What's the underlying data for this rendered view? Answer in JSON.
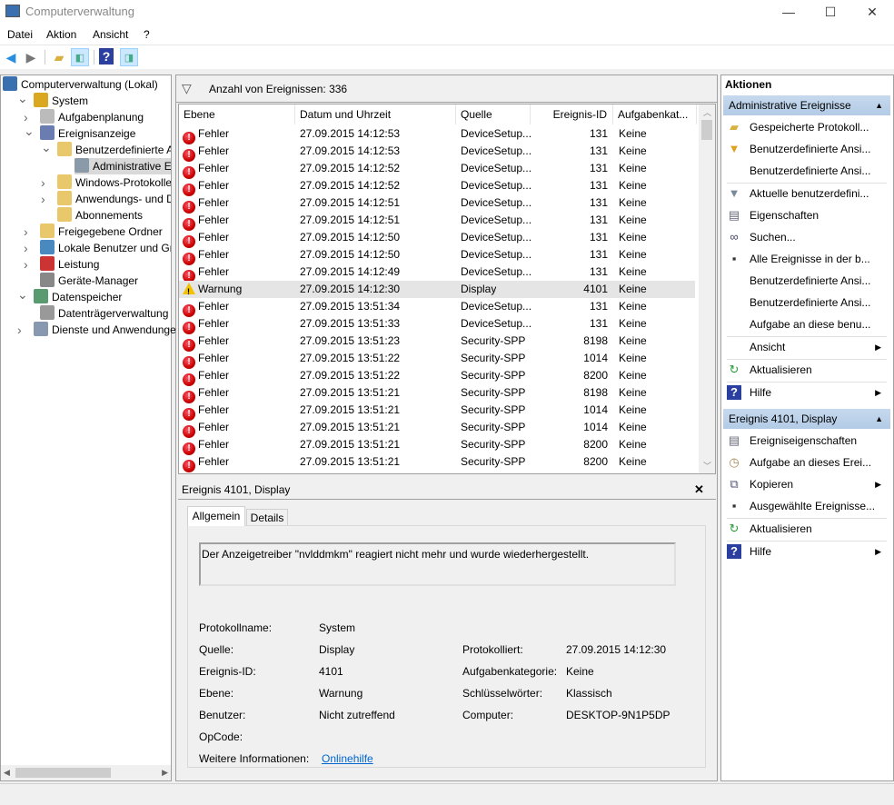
{
  "window": {
    "title": "Computerverwaltung",
    "minimize": "—",
    "maximize": "☐",
    "close": "✕"
  },
  "menu": [
    "Datei",
    "Aktion",
    "Ansicht",
    "?"
  ],
  "toolbar": {
    "icons": [
      "back-arrow-icon",
      "forward-arrow-icon",
      "up-folder-icon",
      "show-hide-tree-icon",
      "help-icon",
      "show-hide-action-pane-icon"
    ]
  },
  "tree": [
    {
      "label": "Computerverwaltung (Lokal)",
      "icon": "computer-icon",
      "level": 0,
      "chev": ""
    },
    {
      "label": "System",
      "icon": "tools-icon",
      "level": 1,
      "chev": "v"
    },
    {
      "label": "Aufgabenplanung",
      "icon": "clock-icon",
      "level": 2,
      "chev": ">"
    },
    {
      "label": "Ereignisanzeige",
      "icon": "event-viewer-icon",
      "level": 2,
      "chev": "v"
    },
    {
      "label": "Benutzerdefinierte Ansichten",
      "icon": "filter-folder-icon",
      "level": 3,
      "chev": "v"
    },
    {
      "label": "Administrative Ereignisse",
      "icon": "filter-icon",
      "level": 4,
      "chev": "",
      "selected": true
    },
    {
      "label": "Windows-Protokolle",
      "icon": "folder-icon",
      "level": 3,
      "chev": ">"
    },
    {
      "label": "Anwendungs- und Dienstprotokolle",
      "icon": "folder-icon",
      "level": 3,
      "chev": ">"
    },
    {
      "label": "Abonnements",
      "icon": "subscription-icon",
      "level": 3,
      "chev": ""
    },
    {
      "label": "Freigegebene Ordner",
      "icon": "shared-folder-icon",
      "level": 2,
      "chev": ">"
    },
    {
      "label": "Lokale Benutzer und Gruppen",
      "icon": "users-icon",
      "level": 2,
      "chev": ">"
    },
    {
      "label": "Leistung",
      "icon": "performance-icon",
      "level": 2,
      "chev": ">"
    },
    {
      "label": "Geräte-Manager",
      "icon": "device-manager-icon",
      "level": 2,
      "chev": ""
    },
    {
      "label": "Datenspeicher",
      "icon": "storage-icon",
      "level": 1,
      "chev": "v"
    },
    {
      "label": "Datenträgerverwaltung",
      "icon": "disk-icon",
      "level": 2,
      "chev": ""
    },
    {
      "label": "Dienste und Anwendungen",
      "icon": "services-icon",
      "level": 1,
      "chev": ">"
    }
  ],
  "events": {
    "count_label": "Anzahl von Ereignissen: 336",
    "columns": [
      "Ebene",
      "Datum und Uhrzeit",
      "Quelle",
      "Ereignis-ID",
      "Aufgabenkat..."
    ],
    "rows": [
      [
        "Fehler",
        "27.09.2015 14:12:53",
        "DeviceSetup...",
        "131",
        "Keine"
      ],
      [
        "Fehler",
        "27.09.2015 14:12:53",
        "DeviceSetup...",
        "131",
        "Keine"
      ],
      [
        "Fehler",
        "27.09.2015 14:12:52",
        "DeviceSetup...",
        "131",
        "Keine"
      ],
      [
        "Fehler",
        "27.09.2015 14:12:52",
        "DeviceSetup...",
        "131",
        "Keine"
      ],
      [
        "Fehler",
        "27.09.2015 14:12:51",
        "DeviceSetup...",
        "131",
        "Keine"
      ],
      [
        "Fehler",
        "27.09.2015 14:12:51",
        "DeviceSetup...",
        "131",
        "Keine"
      ],
      [
        "Fehler",
        "27.09.2015 14:12:50",
        "DeviceSetup...",
        "131",
        "Keine"
      ],
      [
        "Fehler",
        "27.09.2015 14:12:50",
        "DeviceSetup...",
        "131",
        "Keine"
      ],
      [
        "Fehler",
        "27.09.2015 14:12:49",
        "DeviceSetup...",
        "131",
        "Keine"
      ],
      [
        "Warnung",
        "27.09.2015 14:12:30",
        "Display",
        "4101",
        "Keine"
      ],
      [
        "Fehler",
        "27.09.2015 13:51:34",
        "DeviceSetup...",
        "131",
        "Keine"
      ],
      [
        "Fehler",
        "27.09.2015 13:51:33",
        "DeviceSetup...",
        "131",
        "Keine"
      ],
      [
        "Fehler",
        "27.09.2015 13:51:23",
        "Security-SPP",
        "8198",
        "Keine"
      ],
      [
        "Fehler",
        "27.09.2015 13:51:22",
        "Security-SPP",
        "1014",
        "Keine"
      ],
      [
        "Fehler",
        "27.09.2015 13:51:22",
        "Security-SPP",
        "8200",
        "Keine"
      ],
      [
        "Fehler",
        "27.09.2015 13:51:21",
        "Security-SPP",
        "8198",
        "Keine"
      ],
      [
        "Fehler",
        "27.09.2015 13:51:21",
        "Security-SPP",
        "1014",
        "Keine"
      ],
      [
        "Fehler",
        "27.09.2015 13:51:21",
        "Security-SPP",
        "1014",
        "Keine"
      ],
      [
        "Fehler",
        "27.09.2015 13:51:21",
        "Security-SPP",
        "8200",
        "Keine"
      ],
      [
        "Fehler",
        "27.09.2015 13:51:21",
        "Security-SPP",
        "8200",
        "Keine"
      ]
    ],
    "selected_index": 9
  },
  "detail": {
    "title": "Ereignis 4101, Display",
    "close": "✕",
    "tabs": [
      "Allgemein",
      "Details"
    ],
    "active_tab": "Allgemein",
    "message": "Der Anzeigetreiber \"nvlddmkm\" reagiert nicht mehr und wurde wiederhergestellt.",
    "fields_left": [
      [
        "Protokollname:",
        "System"
      ],
      [
        "Quelle:",
        "Display"
      ],
      [
        "Ereignis-ID:",
        "4101"
      ],
      [
        "Ebene:",
        "Warnung"
      ],
      [
        "Benutzer:",
        "Nicht zutreffend"
      ],
      [
        "OpCode:",
        ""
      ],
      [
        "Weitere Informationen:",
        "Onlinehilfe"
      ]
    ],
    "fields_right": [
      [
        "Protokolliert:",
        "27.09.2015 14:12:30"
      ],
      [
        "Aufgabenkategorie:",
        "Keine"
      ],
      [
        "Schlüsselwörter:",
        "Klassisch"
      ],
      [
        "Computer:",
        "DESKTOP-9N1P5DP"
      ]
    ],
    "link_color": "#0066cc"
  },
  "actions": {
    "title": "Aktionen",
    "sections": [
      {
        "title": "Administrative Ereignisse",
        "items": [
          {
            "label": "Gespeicherte Protokoll...",
            "icon": "open-folder-icon"
          },
          {
            "label": "Benutzerdefinierte Ansi...",
            "icon": "filter-create-icon"
          },
          {
            "label": "Benutzerdefinierte Ansi...",
            "icon": ""
          },
          {
            "sep": true
          },
          {
            "label": "Aktuelle benutzerdefini...",
            "icon": "filter-icon"
          },
          {
            "label": "Eigenschaften",
            "icon": "properties-icon"
          },
          {
            "label": "Suchen...",
            "icon": "binoculars-icon"
          },
          {
            "label": "Alle Ereignisse in der b...",
            "icon": "save-icon"
          },
          {
            "label": "Benutzerdefinierte Ansi...",
            "icon": ""
          },
          {
            "label": "Benutzerdefinierte Ansi...",
            "icon": ""
          },
          {
            "label": "Aufgabe an diese benu...",
            "icon": ""
          },
          {
            "sep": true
          },
          {
            "label": "Ansicht",
            "icon": "",
            "submenu": true
          },
          {
            "sep": true
          },
          {
            "label": "Aktualisieren",
            "icon": "refresh-icon"
          },
          {
            "sep": true
          },
          {
            "label": "Hilfe",
            "icon": "help-icon",
            "submenu": true
          }
        ]
      },
      {
        "title": "Ereignis 4101, Display",
        "items": [
          {
            "label": "Ereigniseigenschaften",
            "icon": "properties-icon"
          },
          {
            "label": "Aufgabe an dieses Erei...",
            "icon": "task-clock-icon"
          },
          {
            "label": "Kopieren",
            "icon": "copy-icon",
            "submenu": true
          },
          {
            "label": "Ausgewählte Ereignisse...",
            "icon": "save-icon"
          },
          {
            "sep": true
          },
          {
            "label": "Aktualisieren",
            "icon": "refresh-icon"
          },
          {
            "sep": true
          },
          {
            "label": "Hilfe",
            "icon": "help-icon",
            "submenu": true
          }
        ]
      }
    ]
  },
  "colors": {
    "selection": "#e5e5e5",
    "section_header": "#bcd2ea",
    "error": "#cc0000",
    "warning": "#f2c200"
  }
}
